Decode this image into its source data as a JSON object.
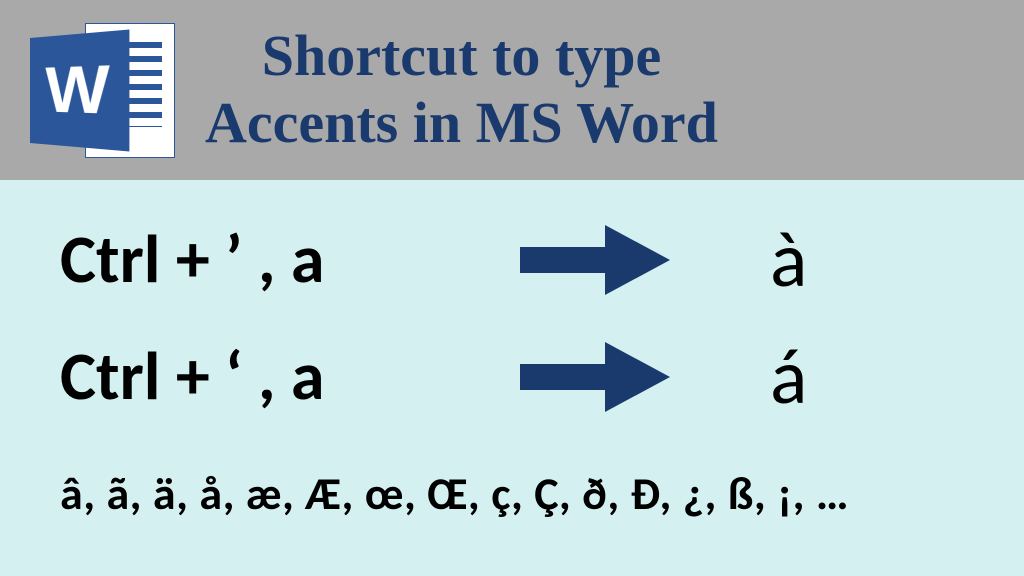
{
  "header": {
    "title_line1": "Shortcut to type",
    "title_line2": "Accents in MS Word",
    "icon_name": "ms-word-icon"
  },
  "shortcuts": [
    {
      "keys": "Ctrl + ’ , a",
      "result": "à"
    },
    {
      "keys": "Ctrl + ‘ , a",
      "result": "á"
    }
  ],
  "characters_list": "â, ã, ä, å, æ, Æ, œ, Œ, ç, Ç, ð, Đ, ¿, ß, ¡, …",
  "colors": {
    "header_bg": "#a9a9a9",
    "content_bg": "#d4f0f0",
    "title_color": "#1a3a6e",
    "arrow_color": "#1a3a6e",
    "word_blue": "#2b579a"
  }
}
